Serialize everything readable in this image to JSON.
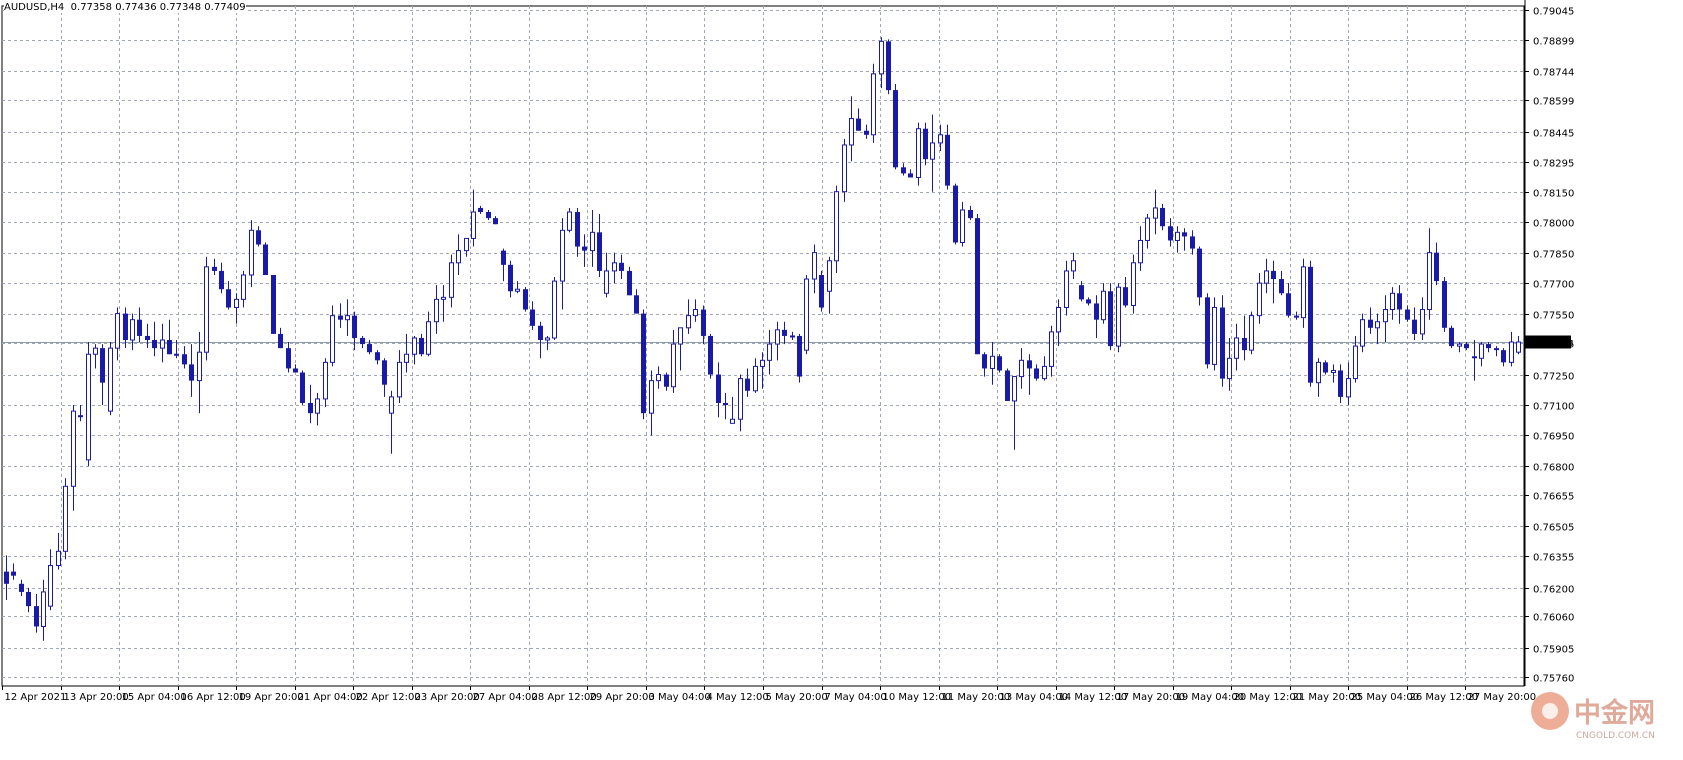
{
  "info": {
    "symbol": "AUDUSD,H4",
    "open": "0.77358",
    "high": "0.77436",
    "low": "0.77348",
    "close": "0.77409"
  },
  "watermark": {
    "cn": "中金网",
    "en": "CNGOLD.COM.CN"
  },
  "colors": {
    "background": "#ffffff",
    "grid": "#a0a8b8",
    "candle": "#1a1aa8",
    "price_line": "#8e9cb0",
    "label_bg": "#000000",
    "label_text": "#ffffff",
    "watermark": "#e06a40"
  },
  "chart_data": {
    "type": "candlestick",
    "symbol": "AUDUSD",
    "timeframe": "H4",
    "current_price": "0.77409",
    "ylim": [
      0.75717,
      0.79064
    ],
    "y_ticks": [
      "0.79045",
      "0.78899",
      "0.78744",
      "0.78599",
      "0.78445",
      "0.78295",
      "0.78150",
      "0.78000",
      "0.77850",
      "0.77700",
      "0.77550",
      "0.77405",
      "0.77250",
      "0.77100",
      "0.76950",
      "0.76800",
      "0.76655",
      "0.76505",
      "0.76355",
      "0.76200",
      "0.76060",
      "0.75905",
      "0.75760"
    ],
    "x_ticks": [
      "12 Apr 2021",
      "13 Apr 20:00",
      "15 Apr 04:00",
      "16 Apr 12:00",
      "19 Apr 20:00",
      "21 Apr 04:00",
      "22 Apr 12:00",
      "23 Apr 20:00",
      "27 Apr 04:00",
      "28 Apr 12:00",
      "29 Apr 20:00",
      "3 May 04:00",
      "4 May 12:00",
      "5 May 20:00",
      "7 May 04:00",
      "10 May 12:00",
      "11 May 20:00",
      "13 May 04:00",
      "14 May 12:00",
      "17 May 20:00",
      "19 May 04:00",
      "20 May 12:00",
      "21 May 20:00",
      "25 May 04:00",
      "26 May 12:00",
      "27 May 20:00"
    ],
    "candles": [
      [
        0.7628,
        0.7636,
        0.7614,
        0.7622
      ],
      [
        0.7628,
        0.7632,
        0.7624,
        0.7626
      ],
      [
        0.7622,
        0.7624,
        0.7616,
        0.7618
      ],
      [
        0.7618,
        0.762,
        0.7608,
        0.7611
      ],
      [
        0.7611,
        0.7617,
        0.7598,
        0.7601
      ],
      [
        0.7601,
        0.7624,
        0.7594,
        0.7618
      ],
      [
        0.7611,
        0.7639,
        0.7609,
        0.7631
      ],
      [
        0.7631,
        0.7647,
        0.7629,
        0.7638
      ],
      [
        0.7638,
        0.7674,
        0.7634,
        0.767
      ],
      [
        0.767,
        0.771,
        0.7658,
        0.7707
      ],
      [
        0.7705,
        0.771,
        0.7702,
        0.7704
      ],
      [
        0.7683,
        0.7741,
        0.768,
        0.7735
      ],
      [
        0.7735,
        0.774,
        0.7728,
        0.7738
      ],
      [
        0.7738,
        0.774,
        0.771,
        0.7721
      ],
      [
        0.7707,
        0.7741,
        0.7705,
        0.7738
      ],
      [
        0.7738,
        0.7758,
        0.7732,
        0.7755
      ],
      [
        0.7755,
        0.7758,
        0.7738,
        0.7742
      ],
      [
        0.7742,
        0.7755,
        0.7737,
        0.7752
      ],
      [
        0.7752,
        0.7758,
        0.7741,
        0.7744
      ],
      [
        0.7744,
        0.775,
        0.7738,
        0.7742
      ],
      [
        0.7742,
        0.7751,
        0.7734,
        0.7738
      ],
      [
        0.7738,
        0.775,
        0.7731,
        0.7742
      ],
      [
        0.7742,
        0.7752,
        0.7735,
        0.7735
      ],
      [
        0.7735,
        0.7742,
        0.7733,
        0.7735
      ],
      [
        0.7735,
        0.7739,
        0.7728,
        0.773
      ],
      [
        0.773,
        0.774,
        0.7714,
        0.7722
      ],
      [
        0.7722,
        0.7746,
        0.7706,
        0.7736
      ],
      [
        0.7736,
        0.7783,
        0.7732,
        0.7778
      ],
      [
        0.7778,
        0.7782,
        0.7774,
        0.7776
      ],
      [
        0.7776,
        0.778,
        0.7765,
        0.7767
      ],
      [
        0.7767,
        0.7771,
        0.7757,
        0.7758
      ],
      [
        0.7758,
        0.7765,
        0.775,
        0.7762
      ],
      [
        0.7762,
        0.7776,
        0.7758,
        0.7774
      ],
      [
        0.7774,
        0.7801,
        0.7768,
        0.7796
      ],
      [
        0.7796,
        0.7798,
        0.7788,
        0.7789
      ],
      [
        0.7789,
        0.779,
        0.7774,
        0.7774
      ],
      [
        0.7774,
        0.7774,
        0.7745,
        0.7745
      ],
      [
        0.7745,
        0.7748,
        0.7738,
        0.7738
      ],
      [
        0.7738,
        0.7741,
        0.7726,
        0.7728
      ],
      [
        0.7728,
        0.773,
        0.7726,
        0.7726
      ],
      [
        0.7726,
        0.7727,
        0.771,
        0.7711
      ],
      [
        0.7711,
        0.772,
        0.7701,
        0.7706
      ],
      [
        0.7706,
        0.7716,
        0.77,
        0.7713
      ],
      [
        0.7713,
        0.7733,
        0.7709,
        0.7731
      ],
      [
        0.7731,
        0.7759,
        0.7729,
        0.7754
      ],
      [
        0.7754,
        0.776,
        0.7748,
        0.7752
      ],
      [
        0.7752,
        0.7762,
        0.7744,
        0.7754
      ],
      [
        0.7754,
        0.7756,
        0.7737,
        0.7743
      ],
      [
        0.7743,
        0.7744,
        0.7738,
        0.774
      ],
      [
        0.774,
        0.7742,
        0.7735,
        0.7736
      ],
      [
        0.7736,
        0.7737,
        0.773,
        0.7732
      ],
      [
        0.7732,
        0.7733,
        0.7714,
        0.772
      ],
      [
        0.7706,
        0.7717,
        0.7686,
        0.7714
      ],
      [
        0.7714,
        0.7737,
        0.7711,
        0.7731
      ],
      [
        0.7731,
        0.7745,
        0.7726,
        0.7735
      ],
      [
        0.7735,
        0.7744,
        0.773,
        0.7743
      ],
      [
        0.7743,
        0.7745,
        0.7734,
        0.7735
      ],
      [
        0.7735,
        0.7756,
        0.7734,
        0.7751
      ],
      [
        0.7751,
        0.7769,
        0.7745,
        0.7762
      ],
      [
        0.7762,
        0.7769,
        0.7751,
        0.7763
      ],
      [
        0.7763,
        0.7784,
        0.7758,
        0.778
      ],
      [
        0.778,
        0.7794,
        0.7774,
        0.7786
      ],
      [
        0.7786,
        0.7791,
        0.7783,
        0.7792
      ],
      [
        0.7792,
        0.7816,
        0.7788,
        0.7805
      ],
      [
        0.7807,
        0.7808,
        0.7804,
        0.7805
      ],
      [
        0.7805,
        0.7806,
        0.7801,
        0.7802
      ],
      [
        0.7802,
        0.7803,
        0.7799,
        0.7799
      ],
      [
        0.7786,
        0.7787,
        0.7771,
        0.7779
      ],
      [
        0.7779,
        0.7781,
        0.7763,
        0.7766
      ],
      [
        0.7766,
        0.7771,
        0.7765,
        0.7767
      ],
      [
        0.7767,
        0.7768,
        0.7756,
        0.7757
      ],
      [
        0.7757,
        0.7761,
        0.7747,
        0.7749
      ],
      [
        0.7749,
        0.7751,
        0.7733,
        0.7742
      ],
      [
        0.7742,
        0.7744,
        0.7737,
        0.7743
      ],
      [
        0.7743,
        0.7773,
        0.7742,
        0.7771
      ],
      [
        0.7771,
        0.7802,
        0.7757,
        0.7796
      ],
      [
        0.7796,
        0.7807,
        0.7795,
        0.7805
      ],
      [
        0.7805,
        0.7807,
        0.7783,
        0.7788
      ],
      [
        0.7788,
        0.7794,
        0.7778,
        0.7786
      ],
      [
        0.7786,
        0.7806,
        0.7778,
        0.7795
      ],
      [
        0.7795,
        0.7804,
        0.7773,
        0.7776
      ],
      [
        0.7765,
        0.7785,
        0.7763,
        0.7776
      ],
      [
        0.7776,
        0.7785,
        0.777,
        0.778
      ],
      [
        0.778,
        0.7784,
        0.7772,
        0.7776
      ],
      [
        0.7776,
        0.7778,
        0.7764,
        0.7764
      ],
      [
        0.7764,
        0.7767,
        0.7755,
        0.7755
      ],
      [
        0.7755,
        0.7757,
        0.7703,
        0.7706
      ],
      [
        0.7706,
        0.7727,
        0.7695,
        0.7722
      ],
      [
        0.7722,
        0.7729,
        0.7718,
        0.7725
      ],
      [
        0.7725,
        0.7726,
        0.7717,
        0.7719
      ],
      [
        0.7719,
        0.7747,
        0.7716,
        0.774
      ],
      [
        0.774,
        0.7748,
        0.7727,
        0.7748
      ],
      [
        0.7748,
        0.7762,
        0.7745,
        0.7754
      ],
      [
        0.7754,
        0.7762,
        0.7751,
        0.7757
      ],
      [
        0.7757,
        0.7759,
        0.774,
        0.7744
      ],
      [
        0.7744,
        0.7745,
        0.7723,
        0.7725
      ],
      [
        0.7725,
        0.7731,
        0.7704,
        0.7711
      ],
      [
        0.7711,
        0.7716,
        0.7703,
        0.771
      ],
      [
        0.7701,
        0.7714,
        0.7701,
        0.7703
      ],
      [
        0.7703,
        0.7725,
        0.7697,
        0.7723
      ],
      [
        0.7723,
        0.7728,
        0.7714,
        0.7717
      ],
      [
        0.7717,
        0.7733,
        0.7716,
        0.7729
      ],
      [
        0.7729,
        0.7736,
        0.7718,
        0.7732
      ],
      [
        0.7732,
        0.7747,
        0.7725,
        0.774
      ],
      [
        0.774,
        0.7751,
        0.7732,
        0.7747
      ],
      [
        0.7747,
        0.7751,
        0.774,
        0.7744
      ],
      [
        0.7744,
        0.7746,
        0.7742,
        0.7744
      ],
      [
        0.7744,
        0.7745,
        0.7721,
        0.7724
      ],
      [
        0.7737,
        0.7774,
        0.7735,
        0.7772
      ],
      [
        0.7772,
        0.7789,
        0.7765,
        0.7785
      ],
      [
        0.7774,
        0.7776,
        0.7756,
        0.7758
      ],
      [
        0.7766,
        0.7783,
        0.7755,
        0.7781
      ],
      [
        0.7781,
        0.7818,
        0.7775,
        0.7815
      ],
      [
        0.7815,
        0.7841,
        0.781,
        0.7838
      ],
      [
        0.7838,
        0.7862,
        0.783,
        0.7851
      ],
      [
        0.7851,
        0.7856,
        0.7845,
        0.7845
      ],
      [
        0.7845,
        0.7848,
        0.7841,
        0.7843
      ],
      [
        0.7843,
        0.7878,
        0.7839,
        0.7873
      ],
      [
        0.7873,
        0.7891,
        0.7866,
        0.7889
      ],
      [
        0.7889,
        0.789,
        0.7863,
        0.7865
      ],
      [
        0.7865,
        0.7868,
        0.7826,
        0.7827
      ],
      [
        0.7827,
        0.7829,
        0.7823,
        0.7824
      ],
      [
        0.7824,
        0.7826,
        0.7822,
        0.7822
      ],
      [
        0.7822,
        0.7849,
        0.7818,
        0.7846
      ],
      [
        0.7846,
        0.7849,
        0.7828,
        0.7831
      ],
      [
        0.7831,
        0.7853,
        0.7815,
        0.7839
      ],
      [
        0.7839,
        0.7848,
        0.7835,
        0.7843
      ],
      [
        0.7843,
        0.7848,
        0.7816,
        0.7818
      ],
      [
        0.7818,
        0.7819,
        0.7789,
        0.779
      ],
      [
        0.779,
        0.781,
        0.7788,
        0.7806
      ],
      [
        0.7806,
        0.7808,
        0.7801,
        0.7802
      ],
      [
        0.7802,
        0.7804,
        0.7735,
        0.7735
      ],
      [
        0.7735,
        0.7736,
        0.7724,
        0.7728
      ],
      [
        0.7728,
        0.7741,
        0.772,
        0.7734
      ],
      [
        0.7734,
        0.7735,
        0.7726,
        0.7727
      ],
      [
        0.7727,
        0.7728,
        0.7712,
        0.7712
      ],
      [
        0.7712,
        0.7719,
        0.7688,
        0.7724
      ],
      [
        0.7724,
        0.7738,
        0.7718,
        0.7732
      ],
      [
        0.7732,
        0.7735,
        0.7715,
        0.7728
      ],
      [
        0.7728,
        0.773,
        0.7722,
        0.7723
      ],
      [
        0.7723,
        0.7734,
        0.7722,
        0.7729
      ],
      [
        0.7729,
        0.7749,
        0.7724,
        0.7746
      ],
      [
        0.7746,
        0.7762,
        0.7739,
        0.7758
      ],
      [
        0.7758,
        0.7781,
        0.7754,
        0.7776
      ],
      [
        0.7776,
        0.7785,
        0.7772,
        0.7781
      ],
      [
        0.7769,
        0.7771,
        0.7761,
        0.7762
      ],
      [
        0.7762,
        0.7763,
        0.7759,
        0.776
      ],
      [
        0.776,
        0.7764,
        0.7743,
        0.7752
      ],
      [
        0.7752,
        0.777,
        0.775,
        0.7766
      ],
      [
        0.7766,
        0.777,
        0.7737,
        0.7739
      ],
      [
        0.7739,
        0.777,
        0.7736,
        0.7768
      ],
      [
        0.7768,
        0.7773,
        0.7758,
        0.7759
      ],
      [
        0.7759,
        0.7784,
        0.7755,
        0.778
      ],
      [
        0.778,
        0.7798,
        0.7776,
        0.7791
      ],
      [
        0.7791,
        0.7804,
        0.7787,
        0.7802
      ],
      [
        0.7802,
        0.7816,
        0.7794,
        0.7807
      ],
      [
        0.7807,
        0.7809,
        0.7796,
        0.7798
      ],
      [
        0.7798,
        0.7802,
        0.7788,
        0.7791
      ],
      [
        0.7791,
        0.7798,
        0.7785,
        0.7795
      ],
      [
        0.7795,
        0.7797,
        0.7786,
        0.7793
      ],
      [
        0.7793,
        0.7796,
        0.7784,
        0.7787
      ],
      [
        0.7787,
        0.7788,
        0.7759,
        0.7763
      ],
      [
        0.7763,
        0.7765,
        0.7728,
        0.773
      ],
      [
        0.773,
        0.7763,
        0.7727,
        0.7758
      ],
      [
        0.7758,
        0.7764,
        0.7719,
        0.7723
      ],
      [
        0.7723,
        0.7743,
        0.7717,
        0.7733
      ],
      [
        0.7733,
        0.775,
        0.7727,
        0.7743
      ],
      [
        0.7743,
        0.7754,
        0.7732,
        0.7737
      ],
      [
        0.7737,
        0.7756,
        0.7735,
        0.7754
      ],
      [
        0.7754,
        0.7775,
        0.775,
        0.777
      ],
      [
        0.777,
        0.7782,
        0.7765,
        0.7776
      ],
      [
        0.7776,
        0.7781,
        0.776,
        0.7772
      ],
      [
        0.7772,
        0.7776,
        0.7764,
        0.7765
      ],
      [
        0.7765,
        0.777,
        0.7753,
        0.7754
      ],
      [
        0.7754,
        0.7756,
        0.7752,
        0.7753
      ],
      [
        0.7753,
        0.7782,
        0.7748,
        0.7778
      ],
      [
        0.7778,
        0.7781,
        0.7719,
        0.7721
      ],
      [
        0.7721,
        0.7733,
        0.7714,
        0.7731
      ],
      [
        0.7731,
        0.7732,
        0.7725,
        0.7726
      ],
      [
        0.7726,
        0.773,
        0.7721,
        0.7727
      ],
      [
        0.7727,
        0.773,
        0.7711,
        0.7714
      ],
      [
        0.7714,
        0.7731,
        0.771,
        0.7723
      ],
      [
        0.7723,
        0.7744,
        0.7721,
        0.7739
      ],
      [
        0.7739,
        0.7755,
        0.7736,
        0.7752
      ],
      [
        0.7752,
        0.7758,
        0.7745,
        0.7748
      ],
      [
        0.7748,
        0.7755,
        0.774,
        0.7751
      ],
      [
        0.7751,
        0.7764,
        0.7741,
        0.7757
      ],
      [
        0.7757,
        0.7768,
        0.7752,
        0.7765
      ],
      [
        0.7765,
        0.7769,
        0.775,
        0.7757
      ],
      [
        0.7757,
        0.7759,
        0.7751,
        0.7752
      ],
      [
        0.7752,
        0.7758,
        0.7742,
        0.7745
      ],
      [
        0.7745,
        0.7763,
        0.7742,
        0.7757
      ],
      [
        0.7757,
        0.7797,
        0.7752,
        0.7785
      ],
      [
        0.7785,
        0.779,
        0.7769,
        0.7771
      ],
      [
        0.7771,
        0.7773,
        0.7746,
        0.7748
      ],
      [
        0.7748,
        0.7749,
        0.7738,
        0.7739
      ],
      [
        0.7739,
        0.7741,
        0.7736,
        0.774
      ],
      [
        0.774,
        0.7741,
        0.7737,
        0.7738
      ],
      [
        0.7734,
        0.7742,
        0.7722,
        0.7733
      ],
      [
        0.7733,
        0.7741,
        0.7729,
        0.774
      ],
      [
        0.774,
        0.7741,
        0.7736,
        0.7738
      ],
      [
        0.7738,
        0.7739,
        0.7734,
        0.7737
      ],
      [
        0.7737,
        0.7738,
        0.7729,
        0.7731
      ],
      [
        0.7731,
        0.7746,
        0.7729,
        0.7741
      ],
      [
        0.7736,
        0.7744,
        0.7735,
        0.7741
      ]
    ]
  }
}
